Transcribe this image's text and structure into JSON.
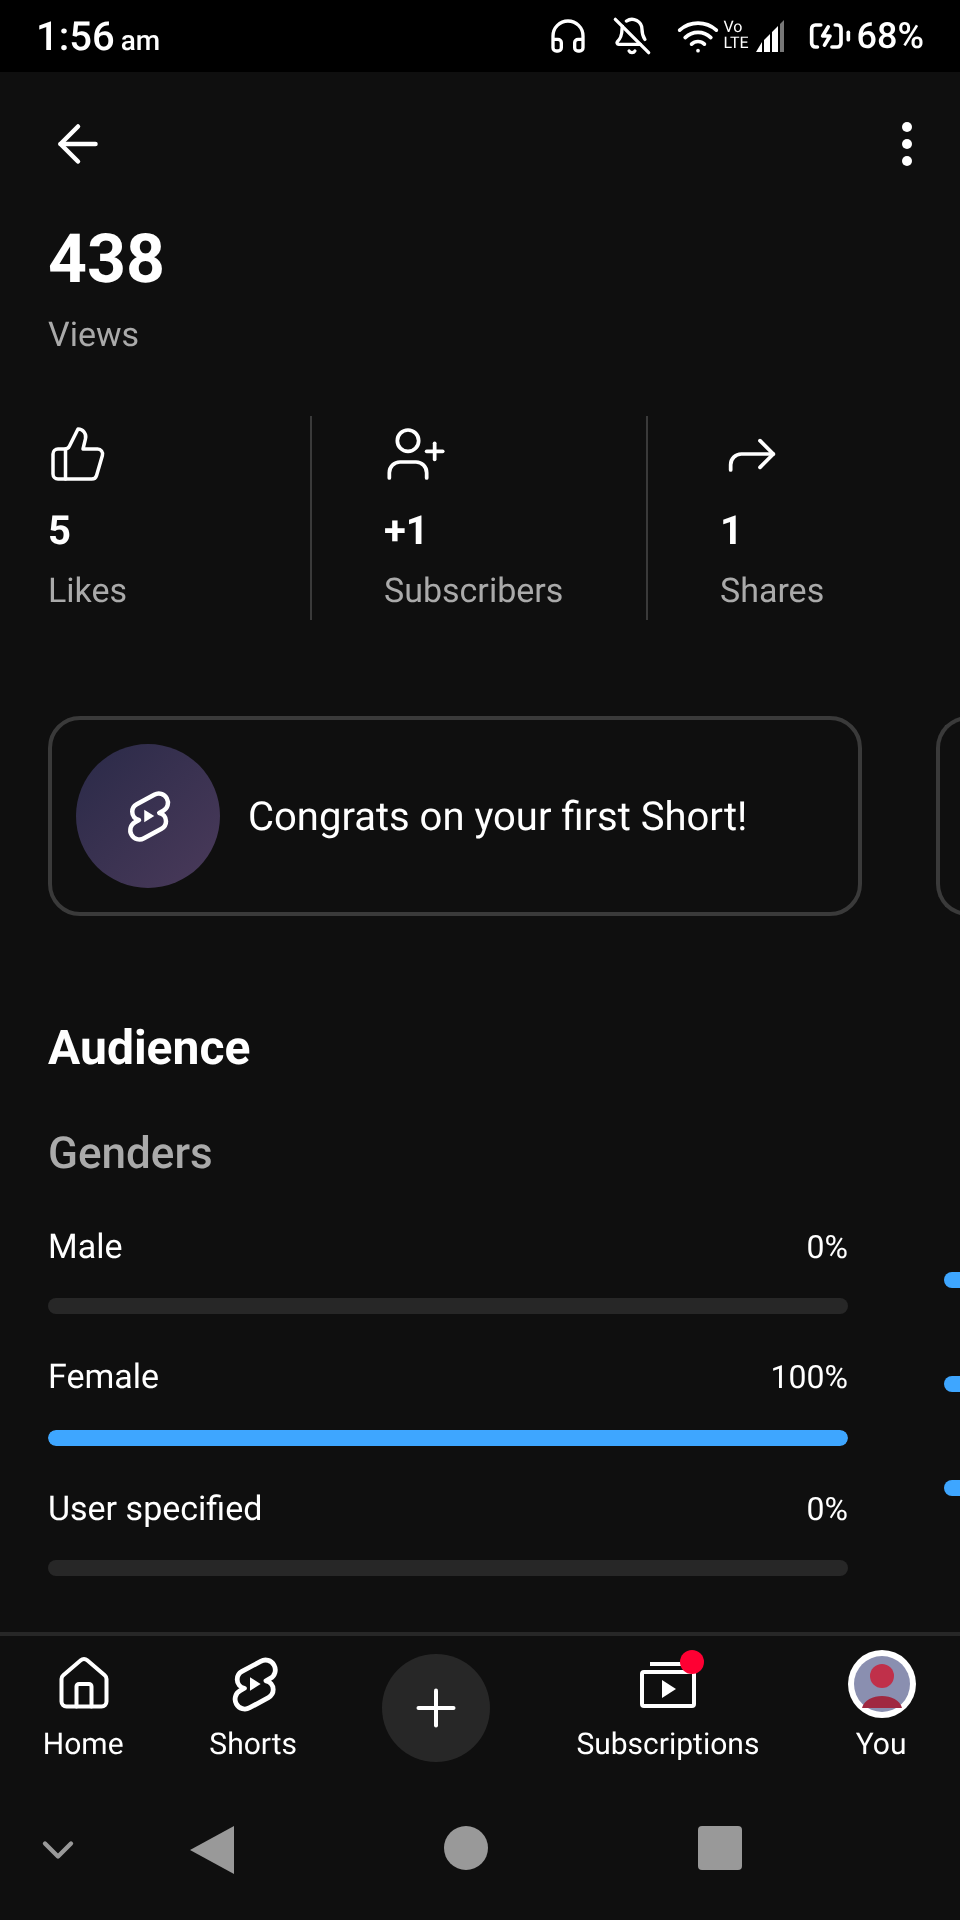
{
  "status_bar": {
    "time": "1:56",
    "meridiem": "am",
    "network_label": [
      "Vo",
      "LTE"
    ],
    "battery": "68%"
  },
  "summary": {
    "value": "438",
    "label": "Views"
  },
  "stats": [
    {
      "kind": "likes",
      "value": "5",
      "label": "Likes"
    },
    {
      "kind": "subscribers",
      "value": "+1",
      "label": "Subscribers"
    },
    {
      "kind": "shares",
      "value": "1",
      "label": "Shares"
    }
  ],
  "cards": [
    {
      "text": "Congrats on your first Short!"
    }
  ],
  "audience": {
    "title": "Audience",
    "columns": [
      {
        "title": "Genders",
        "rows": [
          {
            "label": "Male",
            "value": "0%",
            "level": 0
          },
          {
            "label": "Female",
            "value": "100%",
            "level": 1
          },
          {
            "label": "User specified",
            "value": "0%",
            "level": 0
          }
        ]
      }
    ]
  },
  "bottom_nav": [
    {
      "kind": "home",
      "label": "Home",
      "badge": false
    },
    {
      "kind": "shorts",
      "label": "Shorts",
      "badge": false
    },
    {
      "kind": "create"
    },
    {
      "kind": "subscriptions",
      "label": "Subscriptions",
      "badge": true
    },
    {
      "kind": "you",
      "label": "You",
      "badge": false
    }
  ]
}
